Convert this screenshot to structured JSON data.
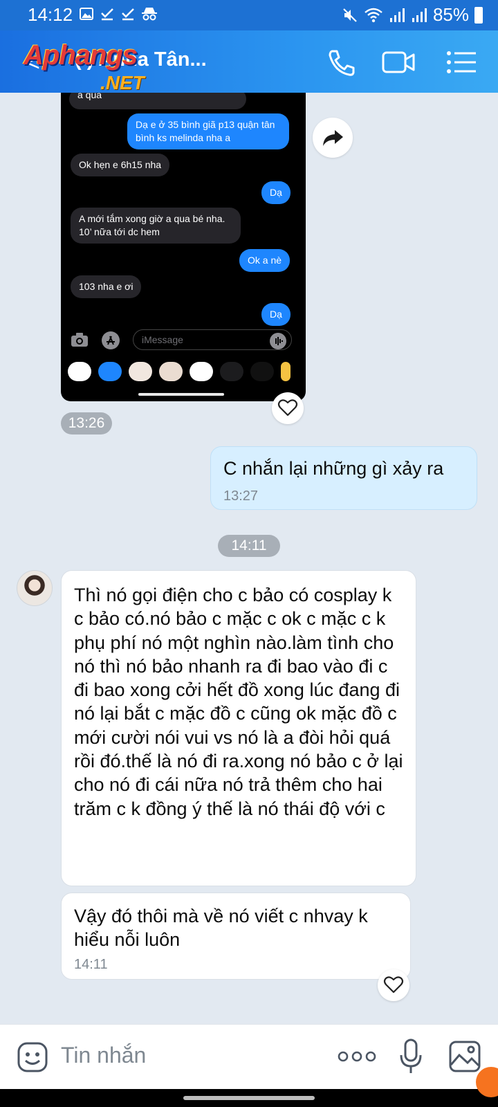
{
  "status_bar": {
    "time": "14:12",
    "battery": "85%"
  },
  "header": {
    "back_label": "<",
    "title": "(                  ) Anna Tân...",
    "watermark_top": "Aphangs",
    "watermark_bottom": ".NET",
    "icons": [
      "phone-icon",
      "video-call-icon",
      "menu-icon"
    ]
  },
  "screenshot": {
    "messages": [
      {
        "dir": "in",
        "text": "a qua"
      },
      {
        "dir": "out",
        "text": "Dạ e ở 35 bình giã p13 quận tân bình ks melinda nha a"
      },
      {
        "dir": "in",
        "text": "Ok hẹn e 6h15 nha"
      },
      {
        "dir": "out",
        "text": "Dạ"
      },
      {
        "dir": "in",
        "text": "A mới tắm xong giờ a qua bé nha. 10’ nữa tới dc hem"
      },
      {
        "dir": "out",
        "text": "Ok a nè"
      },
      {
        "dir": "in",
        "text": "103 nha e ơi"
      },
      {
        "dir": "out",
        "text": "Dạ"
      }
    ],
    "input_placeholder": "iMessage",
    "time": "13:26"
  },
  "chat": [
    {
      "id": "m1",
      "dir": "me",
      "text": "C nhắn lại những gì xảy ra",
      "time": "13:27"
    },
    {
      "id": "sep",
      "type": "separator",
      "time": "14:11"
    },
    {
      "id": "m2",
      "dir": "them",
      "text": "Thì nó gọi điện cho c bảo có cosplay k c bảo có.nó bảo c mặc c ok c mặc c k phụ phí nó một nghìn nào.làm tình cho nó thì nó bảo nhanh ra đi bao vào đi c đi bao xong cởi hết đồ xong lúc đang đi nó lại bắt c mặc đồ c cũng ok mặc đồ c mới cười nói vui vs nó là a đòi hỏi quá rồi đó.thế là nó đi ra.xong nó bảo c ở lại cho nó đi cái nữa nó trả thêm cho hai trăm c k đồng ý thế là nó thái độ với c"
    },
    {
      "id": "m3",
      "dir": "them",
      "text": "Vậy đó thôi mà về nó viết c nhvay k hiểu nỗi luôn",
      "time": "14:11"
    }
  ],
  "composer": {
    "placeholder": "Tin nhắn",
    "icons": [
      "sticker-icon",
      "more-icon",
      "microphone-icon",
      "image-icon"
    ]
  }
}
